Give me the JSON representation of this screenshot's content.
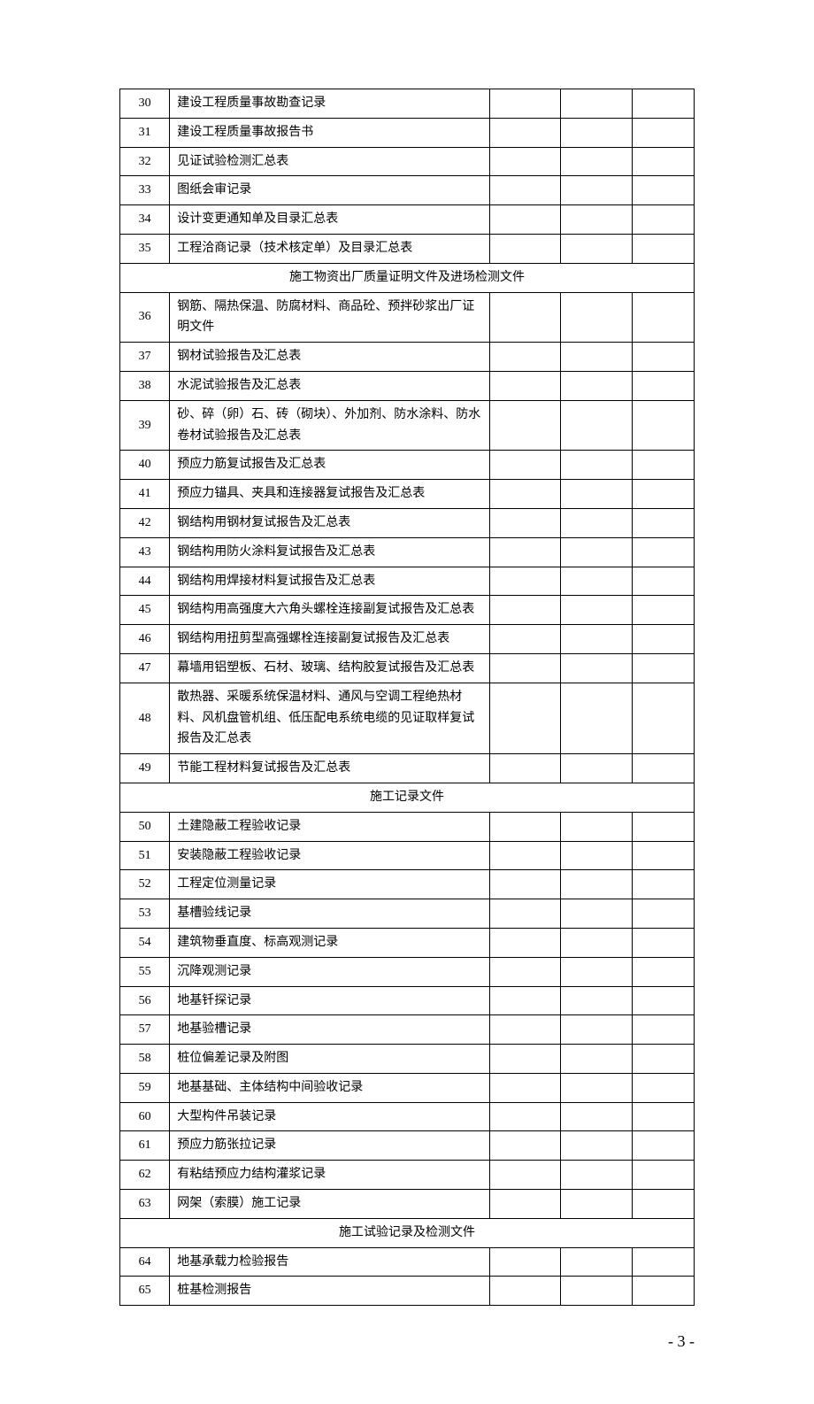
{
  "rows": [
    {
      "type": "row",
      "num": "30",
      "desc": "建设工程质量事故勘查记录"
    },
    {
      "type": "row",
      "num": "31",
      "desc": "建设工程质量事故报告书"
    },
    {
      "type": "row",
      "num": "32",
      "desc": "见证试验检测汇总表"
    },
    {
      "type": "row",
      "num": "33",
      "desc": "图纸会审记录"
    },
    {
      "type": "row",
      "num": "34",
      "desc": "设计变更通知单及目录汇总表"
    },
    {
      "type": "row",
      "num": "35",
      "desc": "工程洽商记录（技术核定单）及目录汇总表"
    },
    {
      "type": "section",
      "title": "施工物资出厂质量证明文件及进场检测文件"
    },
    {
      "type": "row",
      "num": "36",
      "desc": "钢筋、隔热保温、防腐材料、商品砼、预拌砂浆出厂证明文件"
    },
    {
      "type": "row",
      "num": "37",
      "desc": "钢材试验报告及汇总表"
    },
    {
      "type": "row",
      "num": "38",
      "desc": "水泥试验报告及汇总表"
    },
    {
      "type": "row",
      "num": "39",
      "desc": "砂、碎（卵）石、砖（砌块）、外加剂、防水涂料、防水卷材试验报告及汇总表"
    },
    {
      "type": "row",
      "num": "40",
      "desc": "预应力筋复试报告及汇总表"
    },
    {
      "type": "row",
      "num": "41",
      "desc": "预应力锚具、夹具和连接器复试报告及汇总表"
    },
    {
      "type": "row",
      "num": "42",
      "desc": "钢结构用钢材复试报告及汇总表"
    },
    {
      "type": "row",
      "num": "43",
      "desc": "钢结构用防火涂料复试报告及汇总表"
    },
    {
      "type": "row",
      "num": "44",
      "desc": "钢结构用焊接材料复试报告及汇总表"
    },
    {
      "type": "row",
      "num": "45",
      "desc": "钢结构用高强度大六角头螺栓连接副复试报告及汇总表"
    },
    {
      "type": "row",
      "num": "46",
      "desc": "钢结构用扭剪型高强螺栓连接副复试报告及汇总表"
    },
    {
      "type": "row",
      "num": "47",
      "desc": "幕墙用铝塑板、石材、玻璃、结构胶复试报告及汇总表"
    },
    {
      "type": "row",
      "num": "48",
      "desc": "散热器、采暖系统保温材料、通风与空调工程绝热材料、风机盘管机组、低压配电系统电缆的见证取样复试报告及汇总表"
    },
    {
      "type": "row",
      "num": "49",
      "desc": "节能工程材料复试报告及汇总表"
    },
    {
      "type": "section",
      "title": "施工记录文件"
    },
    {
      "type": "row",
      "num": "50",
      "desc": "土建隐蔽工程验收记录"
    },
    {
      "type": "row",
      "num": "51",
      "desc": "安装隐蔽工程验收记录"
    },
    {
      "type": "row",
      "num": "52",
      "desc": "工程定位测量记录"
    },
    {
      "type": "row",
      "num": "53",
      "desc": "基槽验线记录"
    },
    {
      "type": "row",
      "num": "54",
      "desc": "建筑物垂直度、标高观测记录"
    },
    {
      "type": "row",
      "num": "55",
      "desc": "沉降观测记录"
    },
    {
      "type": "row",
      "num": "56",
      "desc": "地基钎探记录"
    },
    {
      "type": "row",
      "num": "57",
      "desc": "地基验槽记录"
    },
    {
      "type": "row",
      "num": "58",
      "desc": "桩位偏差记录及附图"
    },
    {
      "type": "row",
      "num": "59",
      "desc": "地基基础、主体结构中间验收记录"
    },
    {
      "type": "row",
      "num": "60",
      "desc": "大型构件吊装记录"
    },
    {
      "type": "row",
      "num": "61",
      "desc": "预应力筋张拉记录"
    },
    {
      "type": "row",
      "num": "62",
      "desc": "有粘结预应力结构灌浆记录"
    },
    {
      "type": "row",
      "num": "63",
      "desc": "网架（索膜）施工记录"
    },
    {
      "type": "section",
      "title": "施工试验记录及检测文件"
    },
    {
      "type": "row",
      "num": "64",
      "desc": "地基承载力检验报告"
    },
    {
      "type": "row",
      "num": "65",
      "desc": "桩基检测报告"
    }
  ],
  "page_number": "- 3 -"
}
